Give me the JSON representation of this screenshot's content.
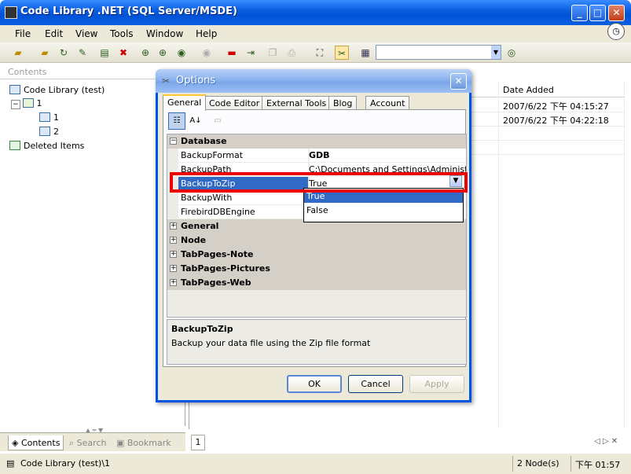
{
  "window": {
    "title": "Code Library .NET (SQL Server/MSDE)",
    "buttons": {
      "minimize": "_",
      "maximize": "□",
      "close": "✕"
    }
  },
  "menu": [
    "File",
    "Edit",
    "View",
    "Tools",
    "Window",
    "Help"
  ],
  "left_panel": {
    "header": "Contents",
    "tree": {
      "root": "Code Library (test)",
      "node": "1",
      "children": [
        "1",
        "2"
      ],
      "deleted": "Deleted Items"
    },
    "tabs": [
      "Contents",
      "Search",
      "Bookmark"
    ]
  },
  "grid": {
    "column": "Date Added",
    "rows": [
      "2007/6/22 下午 04:15:27",
      "2007/6/22 下午 04:22:18"
    ]
  },
  "page_tab": "1",
  "status": {
    "path": "Code Library (test)\\1",
    "nodes": "2 Node(s)",
    "time": "下午 01:57"
  },
  "dialog": {
    "title": "Options",
    "tabs": [
      "General",
      "Code Editor",
      "External Tools",
      "Blog",
      "Account"
    ],
    "categories": {
      "database": "Database",
      "collapsed": [
        "General",
        "Node",
        "TabPages-Note",
        "TabPages-Pictures",
        "TabPages-Web"
      ]
    },
    "properties": [
      {
        "name": "BackupFormat",
        "value": "GDB"
      },
      {
        "name": "BackupPath",
        "value": "C:\\Documents and Settings\\Administra"
      },
      {
        "name": "BackupToZip",
        "value": "True"
      },
      {
        "name": "BackupWith",
        "value": ""
      },
      {
        "name": "FirebirdDBEngine",
        "value": ""
      }
    ],
    "dropdown_options": [
      "True",
      "False"
    ],
    "description": {
      "title": "BackupToZip",
      "text": "Backup your data file using the Zip file format"
    },
    "buttons": {
      "ok": "OK",
      "cancel": "Cancel",
      "apply": "Apply"
    }
  },
  "colors": {
    "titlebar": "#0a5fe0",
    "selection": "#316ac5",
    "highlight_box": "#e00000"
  }
}
